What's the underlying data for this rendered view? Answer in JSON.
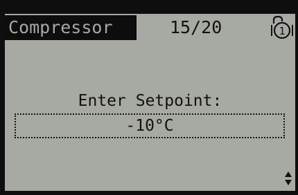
{
  "header": {
    "menu_title": "Compressor",
    "page_counter": "15/20",
    "lock_icon": "padlock-open-icon",
    "lock_number": "1"
  },
  "content": {
    "prompt": "Enter Setpoint:",
    "setpoint_value": "-10°C"
  },
  "footer": {
    "scroll_icon": "up-down-arrows-icon"
  },
  "colors": {
    "bezel": "#0e0e0e",
    "lcd_background": "#a7a9a3",
    "lcd_foreground": "#111111"
  }
}
